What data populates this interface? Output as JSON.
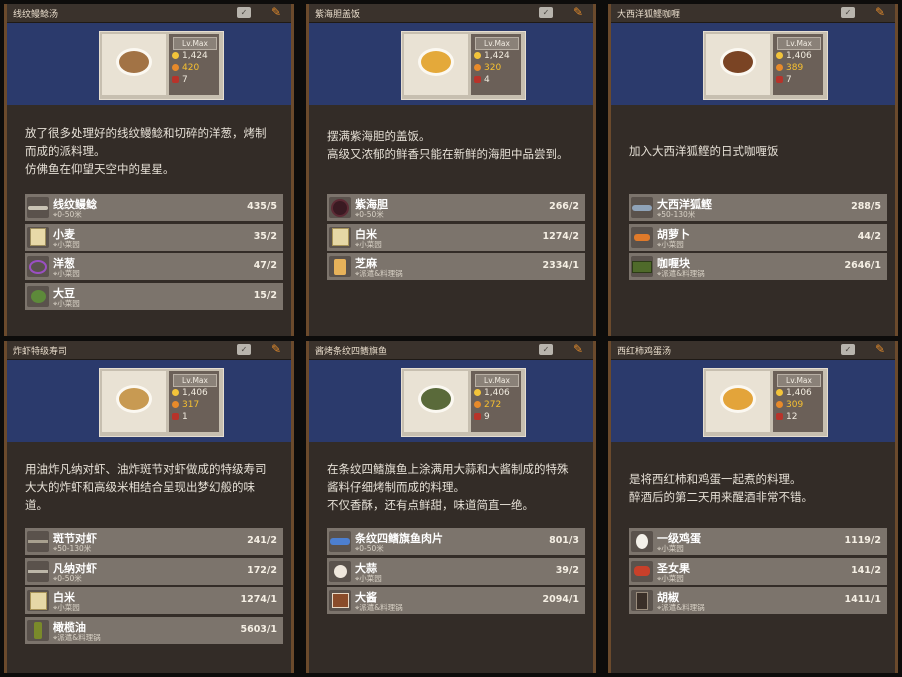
{
  "level_label": "Lv.Max",
  "cards": [
    {
      "title": "线纹鳗鲶汤",
      "dish_color": "#a27345",
      "stats": {
        "price": "1,424",
        "taste": "420",
        "servings": "7"
      },
      "description": [
        "放了很多处理好的线纹鳗鲶和切碎的洋葱，烤制",
        "而成的派料理。",
        "仿佛鱼在仰望天空中的星星。"
      ],
      "ingredients": [
        {
          "name": "线纹鳗鲶",
          "source": "0-50米",
          "count": "435/5",
          "icon": "eel-icon"
        },
        {
          "name": "小麦",
          "source": "小菜园",
          "count": "35/2",
          "icon": "wheat-icon"
        },
        {
          "name": "洋葱",
          "source": "小菜园",
          "count": "47/2",
          "icon": "onion-icon"
        },
        {
          "name": "大豆",
          "source": "小菜园",
          "count": "15/2",
          "icon": "soybean-icon"
        }
      ]
    },
    {
      "title": "紫海胆盖饭",
      "dish_color": "#e4a93a",
      "stats": {
        "price": "1,424",
        "taste": "320",
        "servings": "4"
      },
      "description": [
        "摆满紫海胆的盖饭。",
        "高级又浓郁的鲜香只能在新鲜的海胆中品尝到。"
      ],
      "ingredients": [
        {
          "name": "紫海胆",
          "source": "0-50米",
          "count": "266/2",
          "icon": "sea-urchin-icon"
        },
        {
          "name": "白米",
          "source": "小菜园",
          "count": "1274/2",
          "icon": "rice-icon"
        },
        {
          "name": "芝麻",
          "source": "派遣&料理锅",
          "count": "2334/1",
          "icon": "sesame-icon"
        }
      ]
    },
    {
      "title": "大西洋狐鲣咖喱",
      "dish_color": "#7a4424",
      "stats": {
        "price": "1,406",
        "taste": "389",
        "servings": "7"
      },
      "description": [
        "加入大西洋狐鲣的日式咖喱饭"
      ],
      "ingredients": [
        {
          "name": "大西洋狐鲣",
          "source": "50-130米",
          "count": "288/5",
          "icon": "bonito-icon"
        },
        {
          "name": "胡萝卜",
          "source": "小菜园",
          "count": "44/2",
          "icon": "carrot-icon"
        },
        {
          "name": "咖喱块",
          "source": "派遣&料理锅",
          "count": "2646/1",
          "icon": "curry-block-icon"
        }
      ]
    },
    {
      "title": "炸虾特级寿司",
      "dish_color": "#c89a52",
      "stats": {
        "price": "1,406",
        "taste": "317",
        "servings": "1"
      },
      "description": [
        "用油炸凡纳对虾、油炸斑节对虾做成的特级寿司",
        "大大的炸虾和高级米相结合呈现出梦幻般的味",
        "道。"
      ],
      "ingredients": [
        {
          "name": "斑节对虾",
          "source": "50-130米",
          "count": "241/2",
          "icon": "tiger-shrimp-icon"
        },
        {
          "name": "凡纳对虾",
          "source": "0-50米",
          "count": "172/2",
          "icon": "whiteleg-shrimp-icon"
        },
        {
          "name": "白米",
          "source": "小菜园",
          "count": "1274/1",
          "icon": "rice-icon"
        },
        {
          "name": "橄榄油",
          "source": "派遣&料理锅",
          "count": "5603/1",
          "icon": "olive-oil-icon"
        }
      ]
    },
    {
      "title": "酱烤条纹四鳍旗鱼",
      "dish_color": "#5a6a3a",
      "stats": {
        "price": "1,406",
        "taste": "272",
        "servings": "9"
      },
      "description": [
        "在条纹四鳍旗鱼上涂满用大蒜和大酱制成的特殊",
        "酱料仔细烤制而成的料理。",
        "不仅香酥，还有点鲜甜，味道简直一绝。"
      ],
      "ingredients": [
        {
          "name": "条纹四鳍旗鱼肉片",
          "source": "0-50米",
          "count": "801/3",
          "icon": "marlin-icon"
        },
        {
          "name": "大蒜",
          "source": "小菜园",
          "count": "39/2",
          "icon": "garlic-icon"
        },
        {
          "name": "大酱",
          "source": "派遣&料理锅",
          "count": "2094/1",
          "icon": "soybean-paste-icon"
        }
      ]
    },
    {
      "title": "西红柿鸡蛋汤",
      "dish_color": "#e3a43a",
      "stats": {
        "price": "1,406",
        "taste": "309",
        "servings": "12"
      },
      "description": [
        "是将西红柿和鸡蛋一起煮的料理。",
        "醉酒后的第二天用来醒酒非常不错。"
      ],
      "ingredients": [
        {
          "name": "一级鸡蛋",
          "source": "小菜园",
          "count": "1119/2",
          "icon": "egg-icon"
        },
        {
          "name": "圣女果",
          "source": "小菜园",
          "count": "141/2",
          "icon": "cherry-tomato-icon"
        },
        {
          "name": "胡椒",
          "source": "派遣&料理锅",
          "count": "1411/1",
          "icon": "pepper-icon"
        }
      ]
    }
  ]
}
